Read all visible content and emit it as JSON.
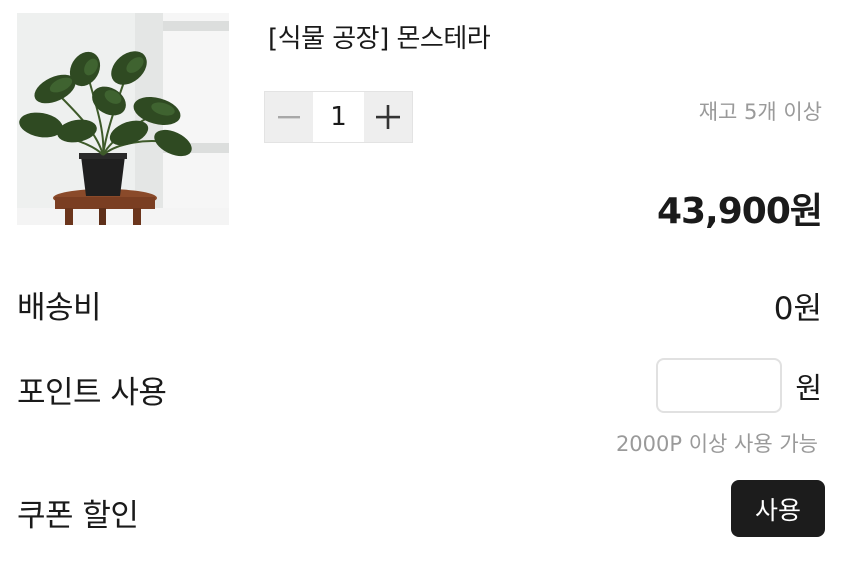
{
  "product": {
    "image_alt": "monstera-plant-photo",
    "name": "[식물 공장] 몬스테라",
    "quantity": "1",
    "stock_text": "재고 5개 이상",
    "price": "43,900원"
  },
  "stepper": {
    "minus_icon": "minus-icon",
    "plus_icon": "plus-icon"
  },
  "shipping": {
    "label": "배송비",
    "value": "0원"
  },
  "points": {
    "label": "포인트 사용",
    "input_value": "",
    "unit": "원",
    "note": "2000P 이상 사용 가능"
  },
  "coupon": {
    "label": "쿠폰 할인",
    "button_label": "사용"
  },
  "colors": {
    "text": "#1a1a1a",
    "muted": "#9a9a9a",
    "button_dark": "#1c1c1c",
    "stepper_bg": "#eeeeee"
  }
}
